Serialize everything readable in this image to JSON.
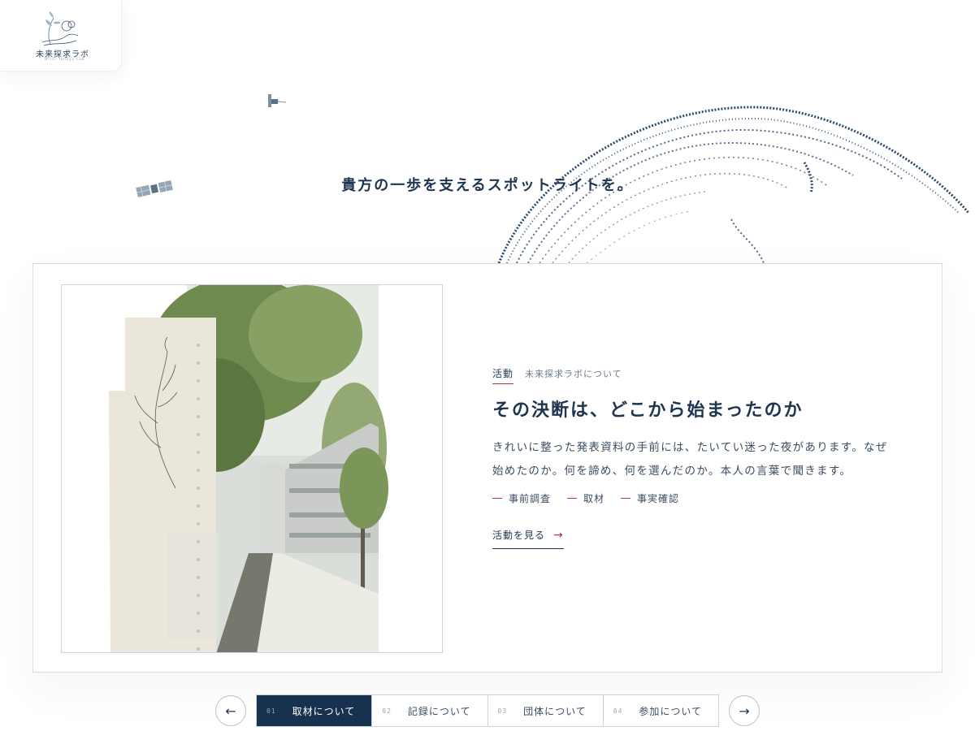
{
  "brand": {
    "logo_text": "未来探求ラボ",
    "logo_sub": "Mirai Tankyu Lab"
  },
  "hero": {
    "tagline": "貴方の一歩を支えるスポットライトを。"
  },
  "feature": {
    "category": "活動",
    "subcategory": "未来探求ラボについて",
    "headline": "その決断は、どこから始まったのか",
    "body": "きれいに整った発表資料の手前には、たいてい迷った夜があります。なぜ始めたのか。何を諦め、何を選んだのか。本人の言葉で聞きます。",
    "tags": [
      "事前調査",
      "取材",
      "事実確認"
    ],
    "link_label": "活動を見る",
    "link_arrow": "→"
  },
  "pager": {
    "prev": "←",
    "next": "→",
    "tabs": [
      {
        "num": "01",
        "label": "取材について",
        "active": true
      },
      {
        "num": "02",
        "label": "記録について",
        "active": false
      },
      {
        "num": "03",
        "label": "団体について",
        "active": false
      },
      {
        "num": "04",
        "label": "参加について",
        "active": false
      }
    ]
  },
  "colors": {
    "primary": "#17324f",
    "accent": "#b33a3a",
    "border": "#c9d3df"
  },
  "icons": {
    "logo": "sprout-logo-icon",
    "globe": "dotted-globe-illustration",
    "satellite": "satellite-icon"
  }
}
